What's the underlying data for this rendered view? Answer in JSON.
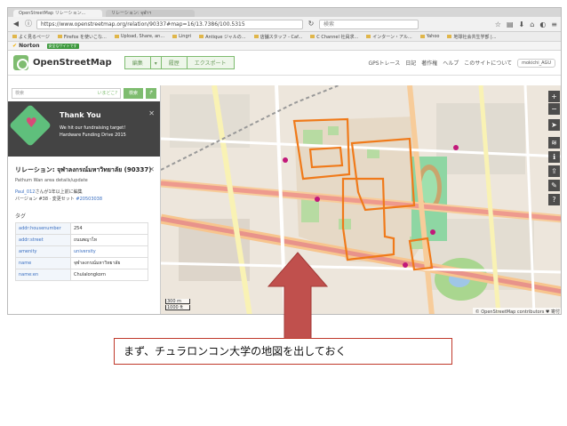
{
  "browser": {
    "tabs": [
      "OpenStreetMap リレーション...",
      "リレーション: จุฬาฯ"
    ],
    "url": "https://www.openstreetmap.org/relation/90337#map=16/13.7386/100.5315",
    "search_placeholder": "検索",
    "bookmarks": [
      "よく見るページ",
      "Firefox を使いこな...",
      "Upload, Share, an...",
      "Lingri",
      "Antique ジャルの...",
      "店舗スタッフ - Caf...",
      "C Channel 社員求...",
      "インターン・アル...",
      "Yahoo",
      "地球社会共生学部 |..."
    ],
    "norton_label": "Norton",
    "safe_search": "安全なサイトです"
  },
  "osm": {
    "logo_text": "OpenStreetMap",
    "edit_button": "編集",
    "history_button": "履歴",
    "export_button": "エクスポート",
    "nav": [
      "GPSトレース",
      "日記",
      "著作権",
      "ヘルプ",
      "このサイトについて"
    ],
    "user": "mokichi_AGU"
  },
  "sidebar": {
    "search_placeholder": "検索",
    "search_where": "いまどこ?",
    "search_button": "検索",
    "donate": {
      "title": "Thank You",
      "text1": "We hit our fundraising target!",
      "text2": "Hardware Funding Drive 2015"
    },
    "relation_title": "リレーション: จุฬาลงกรณ์มหาวิทยาลัย (90337)",
    "relation_sub": "Pathum Wan area details/update",
    "editor_user": "Paul_012",
    "editor_text": "さんが1年以上前に編集",
    "version_label": "バージョン #38 · 変更セット",
    "changeset": "#20503038",
    "tags_heading": "タグ",
    "tags": [
      {
        "key": "addr:housenumber",
        "value": "254"
      },
      {
        "key": "addr:street",
        "value": "ถนนพญาไท"
      },
      {
        "key": "amenity",
        "value": "university"
      },
      {
        "key": "name",
        "value": "จุฬาลงกรณ์มหาวิทยาลัย"
      },
      {
        "key": "name:en",
        "value": "Chulalongkorn"
      }
    ]
  },
  "map": {
    "scale_m": "300 m",
    "scale_ft": "1000 ft",
    "attribution": "© OpenStreetMap contributors ♥ 寄付"
  },
  "caption": "まず、チュラロンコン大学の地図を出しておく",
  "colors": {
    "osm_green": "#7ebc6f",
    "boundary": "#f07a1a",
    "arrow": "#c0504d"
  }
}
